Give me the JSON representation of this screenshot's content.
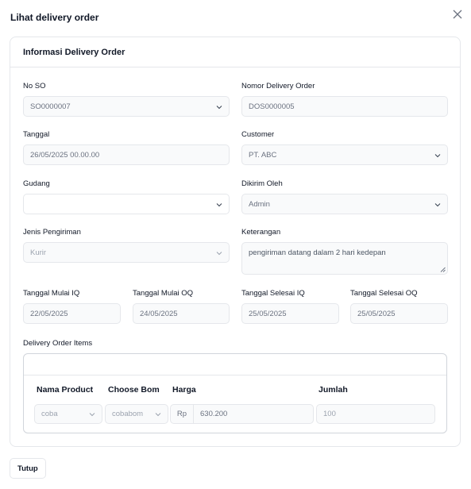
{
  "dialog": {
    "title": "Lihat delivery order",
    "close_label": "close"
  },
  "card": {
    "title": "Informasi Delivery Order"
  },
  "fields": {
    "no_so": {
      "label": "No SO",
      "value": "SO0000007"
    },
    "nomor_do": {
      "label": "Nomor Delivery Order",
      "value": "DOS0000005"
    },
    "tanggal": {
      "label": "Tanggal",
      "value": "26/05/2025 00.00.00"
    },
    "customer": {
      "label": "Customer",
      "value": "PT. ABC"
    },
    "gudang": {
      "label": "Gudang",
      "value": ""
    },
    "dikirim_oleh": {
      "label": "Dikirim Oleh",
      "value": "Admin"
    },
    "jenis_pengiriman": {
      "label": "Jenis Pengiriman",
      "value": "Kurir"
    },
    "keterangan": {
      "label": "Keterangan",
      "value": "pengiriman datang dalam 2 hari kedepan"
    },
    "tgl_mulai_iq": {
      "label": "Tanggal Mulai IQ",
      "value": "22/05/2025"
    },
    "tgl_mulai_oq": {
      "label": "Tanggal Mulai OQ",
      "value": "24/05/2025"
    },
    "tgl_selesai_iq": {
      "label": "Tanggal Selesai IQ",
      "value": "25/05/2025"
    },
    "tgl_selesai_oq": {
      "label": "Tanggal Selesai OQ",
      "value": "25/05/2025"
    }
  },
  "items": {
    "label": "Delivery Order Items",
    "columns": [
      "Nama Product",
      "Choose Bom",
      "Harga",
      "Jumlah"
    ],
    "rows": [
      {
        "product": "coba",
        "bom": "cobabom",
        "currency": "Rp",
        "harga": "630.200",
        "jumlah": "100"
      }
    ]
  },
  "footer": {
    "tutup_label": "Tutup"
  },
  "icons": {
    "close": "close-icon",
    "dropdown": "chevron-down-icon",
    "resize": "resize-grip-icon"
  },
  "colors": {
    "border": "#e5e7eb",
    "field_bg": "#f9fafb",
    "text": "#111827",
    "muted": "#6b7280"
  }
}
